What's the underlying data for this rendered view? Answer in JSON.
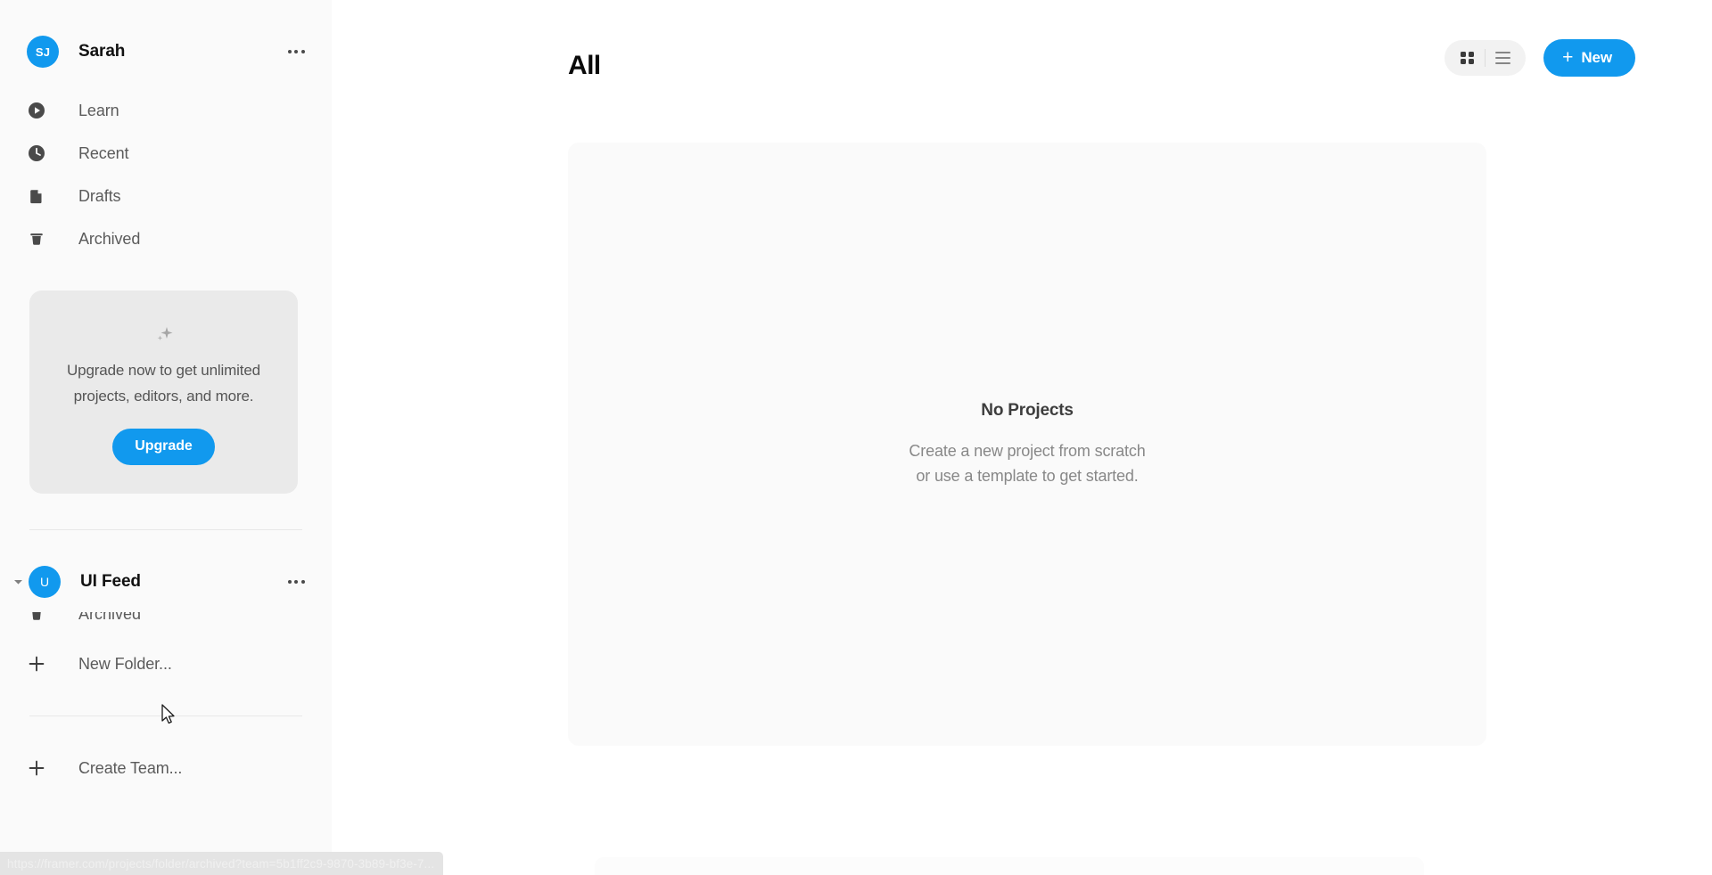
{
  "sidebar": {
    "user": {
      "initials": "SJ",
      "name": "Sarah",
      "avatar_color": "#1199ee",
      "menu_icon": "ellipsis-icon"
    },
    "nav_items": [
      {
        "label": "Learn",
        "icon": "play-circle-icon"
      },
      {
        "label": "Recent",
        "icon": "clock-icon"
      },
      {
        "label": "Drafts",
        "icon": "document-icon"
      },
      {
        "label": "Archived",
        "icon": "trash-icon"
      }
    ],
    "upgrade_card": {
      "icon": "sparkle-icon",
      "text": "Upgrade now to get unlimited projects, editors, and more.",
      "button_label": "Upgrade",
      "button_color": "#1199ee",
      "background": "#eaeaea"
    },
    "team": {
      "initial": "U",
      "name": "UI Feed",
      "avatar_color": "#1199ee",
      "disclosure_icon": "chevron-down-icon",
      "menu_icon": "ellipsis-icon",
      "clipped_item_label": "Archived",
      "clipped_item_icon": "trash-icon",
      "new_folder_label": "New Folder...",
      "new_folder_icon": "plus-icon"
    },
    "create_team": {
      "label": "Create Team...",
      "icon": "plus-icon"
    }
  },
  "main": {
    "page_title": "All",
    "view_toggle": {
      "grid_icon": "grid-view-icon",
      "list_icon": "list-view-icon",
      "active": "grid"
    },
    "new_button": {
      "label": "New",
      "plus": "+",
      "color": "#1199ee"
    },
    "empty_state": {
      "title": "No Projects",
      "line1": "Create a new project from scratch",
      "line2": "or use a template to get started."
    }
  },
  "status_bar": {
    "url": "https://framer.com/projects/folder/archived?team=5b1ff2c9-9870-3b89-bf3e-7..."
  }
}
